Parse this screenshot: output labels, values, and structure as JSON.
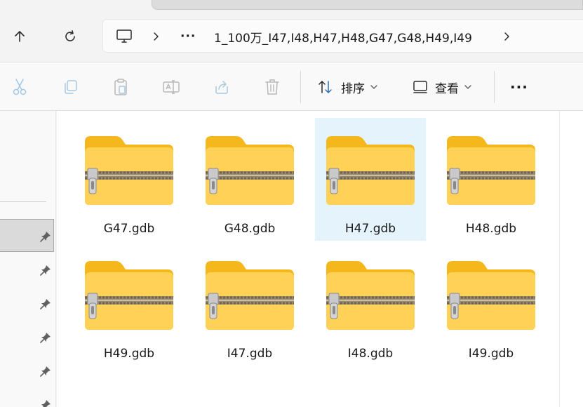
{
  "address": {
    "overflow_label": "···",
    "path": "1_100万_I47,I48,H47,H48,G47,G48,H49,I49"
  },
  "toolbar": {
    "sort_label": "排序",
    "view_label": "查看",
    "more_label": "···"
  },
  "files": [
    {
      "name": "G47.gdb",
      "selected": false
    },
    {
      "name": "G48.gdb",
      "selected": false
    },
    {
      "name": "H47.gdb",
      "selected": true
    },
    {
      "name": "H48.gdb",
      "selected": false
    },
    {
      "name": "H49.gdb",
      "selected": false
    },
    {
      "name": "I47.gdb",
      "selected": false
    },
    {
      "name": "I48.gdb",
      "selected": false
    },
    {
      "name": "I49.gdb",
      "selected": false
    }
  ],
  "colors": {
    "folder_back": "#F4B81C",
    "folder_front": "#FFD257",
    "selection": "#E5F3FD"
  },
  "icons": {
    "back": "arrow-up-icon",
    "refresh": "refresh-icon",
    "computer": "monitor-icon",
    "cut": "scissors-icon",
    "copy": "copy-icon",
    "paste": "clipboard-icon",
    "rename": "rename-icon",
    "share": "share-icon",
    "delete": "trash-icon",
    "sort": "sort-icon",
    "view": "view-icon",
    "pin": "pin-icon",
    "zip_folder": "zip-folder-icon"
  }
}
